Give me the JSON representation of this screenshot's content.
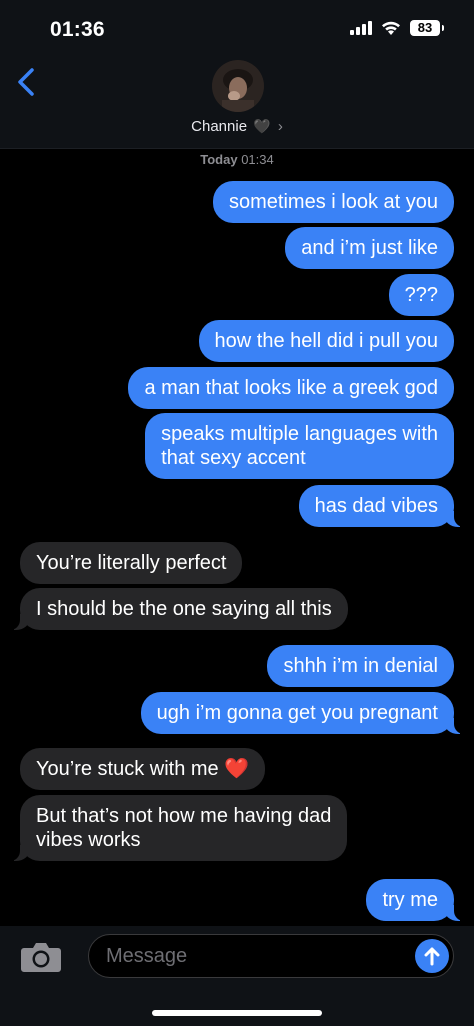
{
  "status_bar": {
    "time": "01:36",
    "battery": "83"
  },
  "header": {
    "contact_name": "Channie",
    "contact_emoji": "🖤",
    "chevron": "›"
  },
  "timestamp": {
    "day": "Today",
    "time": "01:34"
  },
  "messages": [
    {
      "from": "me",
      "text": "sometimes i look at you"
    },
    {
      "from": "me",
      "text": "and i’m just like"
    },
    {
      "from": "me",
      "text": "???"
    },
    {
      "from": "me",
      "text": "how the hell did i pull you"
    },
    {
      "from": "me",
      "text": "a man that looks like a greek god"
    },
    {
      "from": "me",
      "line1": "speaks multiple languages with",
      "line2": "that sexy accent"
    },
    {
      "from": "me",
      "text": "has dad vibes"
    },
    {
      "from": "them",
      "text": "You’re literally perfect"
    },
    {
      "from": "them",
      "text": "I should be the one saying all this"
    },
    {
      "from": "me",
      "text": "shhh i’m in denial"
    },
    {
      "from": "me",
      "text": "ugh i’m gonna get you pregnant"
    },
    {
      "from": "them",
      "text": "You’re stuck with me",
      "emoji": "❤️"
    },
    {
      "from": "them",
      "line1": "But that’s not how me having dad",
      "line2": "vibes works"
    },
    {
      "from": "me",
      "text": "try me"
    }
  ],
  "input_bar": {
    "placeholder": "Message"
  },
  "icons": {
    "back": "chevron-left-icon",
    "camera": "camera-icon",
    "send": "arrow-up-icon",
    "signal": "cellular-signal-icon",
    "wifi": "wifi-icon",
    "battery": "battery-icon"
  },
  "colors": {
    "sent_bubble": "#3a82f6",
    "received_bubble": "#262628",
    "accent": "#3a82f6",
    "background": "#000000"
  }
}
